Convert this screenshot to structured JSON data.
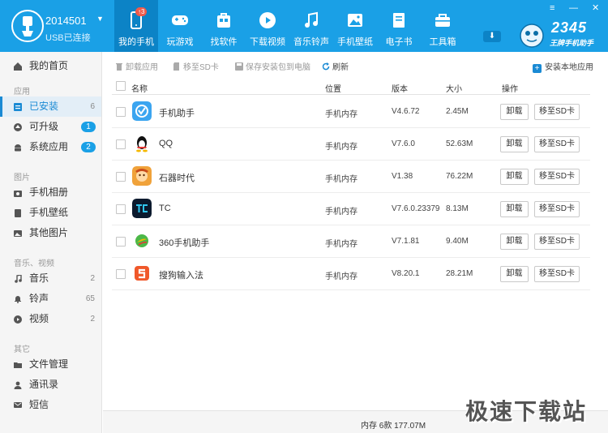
{
  "device": {
    "name": "2014501",
    "status": "USB已连接"
  },
  "nav": [
    {
      "label": "我的手机",
      "badge": "↑3",
      "icon": "phone-icon"
    },
    {
      "label": "玩游戏",
      "icon": "gamepad-icon"
    },
    {
      "label": "找软件",
      "icon": "apps-icon"
    },
    {
      "label": "下载视频",
      "icon": "play-icon"
    },
    {
      "label": "音乐铃声",
      "icon": "music-icon"
    },
    {
      "label": "手机壁纸",
      "icon": "image-icon"
    },
    {
      "label": "电子书",
      "icon": "book-icon"
    },
    {
      "label": "工具箱",
      "icon": "toolbox-icon"
    }
  ],
  "brand": {
    "number": "2345",
    "slogan": "王牌手机助手"
  },
  "window_controls": {
    "menu": "≡",
    "minimize": "—",
    "close": "✕"
  },
  "sidebar": {
    "home": "我的首页",
    "group_apps": "应用",
    "installed": {
      "label": "已安装",
      "count": "6"
    },
    "upgradable": {
      "label": "可升级",
      "count": "1"
    },
    "system_apps": {
      "label": "系统应用",
      "count": "2"
    },
    "group_images": "图片",
    "album": "手机相册",
    "wallpaper": "手机壁纸",
    "other_images": "其他图片",
    "group_media": "音乐、视频",
    "music": {
      "label": "音乐",
      "count": "2"
    },
    "ringtone": {
      "label": "铃声",
      "count": "65"
    },
    "video": {
      "label": "视频",
      "count": "2"
    },
    "group_other": "其它",
    "files": "文件管理",
    "contacts": "通讯录",
    "sms": "短信"
  },
  "toolbar": {
    "uninstall": "卸载应用",
    "move_sd": "移至SD卡",
    "save_pc": "保存安装包到电脑",
    "refresh": "刷新",
    "install_local": "安装本地应用"
  },
  "table": {
    "headers": {
      "name": "名称",
      "location": "位置",
      "version": "版本",
      "size": "大小",
      "actions": "操作"
    },
    "rows": [
      {
        "name": "手机助手",
        "location": "手机内存",
        "version": "V4.6.72",
        "size": "2.45M",
        "uninstall": "卸载",
        "move": "移至SD卡",
        "icon": "assistant-app-icon"
      },
      {
        "name": "QQ",
        "location": "手机内存",
        "version": "V7.6.0",
        "size": "52.63M",
        "uninstall": "卸载",
        "move": "移至SD卡",
        "icon": "qq-app-icon"
      },
      {
        "name": "石器时代",
        "location": "手机内存",
        "version": "V1.38",
        "size": "76.22M",
        "uninstall": "卸载",
        "move": "移至SD卡",
        "icon": "stone-age-app-icon"
      },
      {
        "name": "TC",
        "location": "手机内存",
        "version": "V7.6.0.23379",
        "size": "8.13M",
        "uninstall": "卸载",
        "move": "移至SD卡",
        "icon": "tc-app-icon"
      },
      {
        "name": "360手机助手",
        "location": "手机内存",
        "version": "V7.1.81",
        "size": "9.40M",
        "uninstall": "卸载",
        "move": "移至SD卡",
        "icon": "360-app-icon"
      },
      {
        "name": "搜狗输入法",
        "location": "手机内存",
        "version": "V8.20.1",
        "size": "28.21M",
        "uninstall": "卸载",
        "move": "移至SD卡",
        "icon": "sogou-app-icon"
      }
    ]
  },
  "status": "内存 6款 177.07M",
  "watermark": "极速下载站",
  "colors": {
    "primary": "#1aa0e6",
    "active_nav": "#0c83c6",
    "accent": "#1a8ad4"
  }
}
